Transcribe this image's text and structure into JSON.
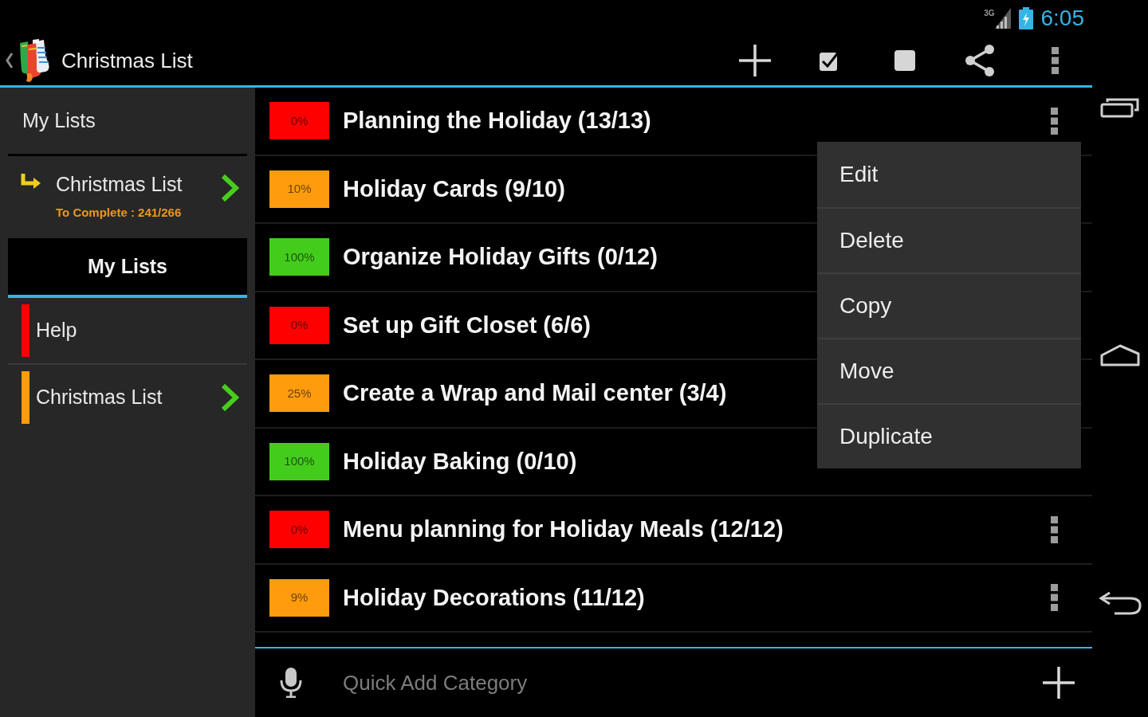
{
  "status_bar": {
    "network": "3G",
    "time": "6:05"
  },
  "action_bar": {
    "title": "Christmas List"
  },
  "sidebar": {
    "title": "My Lists",
    "current_list": {
      "name": "Christmas List",
      "progress": "To Complete : 241/266"
    },
    "section": {
      "label": "My Lists"
    },
    "lists": [
      {
        "name": "Help",
        "color": "#ff0000",
        "has_sublist": false
      },
      {
        "name": "Christmas List",
        "color": "#ff9c0e",
        "has_sublist": true
      }
    ]
  },
  "categories": [
    {
      "badge": "0%",
      "color": "#ff0000",
      "title": "Planning the Holiday (13/13)",
      "more_icon": true
    },
    {
      "badge": "10%",
      "color": "#ff9c0e",
      "title": "Holiday Cards (9/10)",
      "more_icon": false
    },
    {
      "badge": "100%",
      "color": "#44cc1c",
      "title": "Organize Holiday Gifts (0/12)",
      "more_icon": false
    },
    {
      "badge": "0%",
      "color": "#ff0000",
      "title": "Set up Gift Closet (6/6)",
      "more_icon": false
    },
    {
      "badge": "25%",
      "color": "#ff9c0e",
      "title": "Create a Wrap and Mail center (3/4)",
      "more_icon": false
    },
    {
      "badge": "100%",
      "color": "#44cc1c",
      "title": "Holiday Baking (0/10)",
      "more_icon": false
    },
    {
      "badge": "0%",
      "color": "#ff0000",
      "title": "Menu planning for Holiday Meals (12/12)",
      "more_icon": true
    },
    {
      "badge": "9%",
      "color": "#ff9c0e",
      "title": "Holiday Decorations (11/12)",
      "more_icon": true
    }
  ],
  "context_menu": {
    "items": [
      "Edit",
      "Delete",
      "Copy",
      "Move",
      "Duplicate"
    ]
  },
  "quick_add": {
    "placeholder": "Quick Add Category"
  }
}
